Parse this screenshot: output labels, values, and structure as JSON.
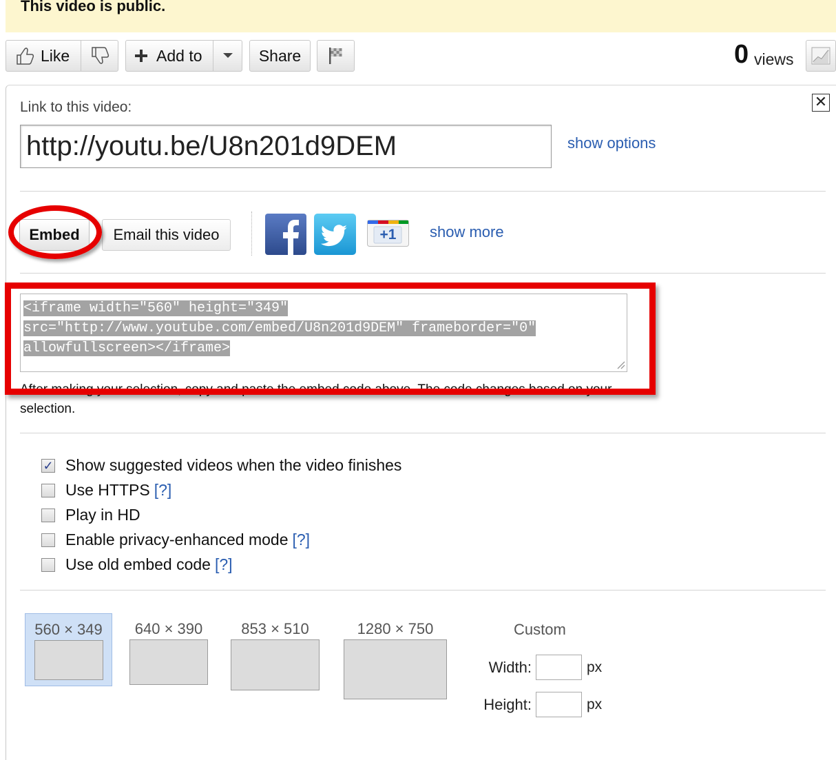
{
  "banner": {
    "text": "This video is public."
  },
  "toolbar": {
    "like_label": "Like",
    "add_to_label": "Add to",
    "share_label": "Share",
    "views_count": "0",
    "views_label": "views"
  },
  "link": {
    "label": "Link to this video:",
    "url": "http://youtu.be/U8n201d9DEM",
    "options_link": "show options"
  },
  "share": {
    "embed_label": "Embed",
    "email_label": "Email this video",
    "gplus_label": "+1",
    "more_link": "show more"
  },
  "embed": {
    "code_lines": [
      "<iframe width=\"560\" height=\"349\"",
      "src=\"http://www.youtube.com/embed/U8n201d9DEM\" frameborder=\"0\"",
      "allowfullscreen></iframe>"
    ],
    "help_text": "After making your selection, copy and paste the embed code above. The code changes based on your selection."
  },
  "options": [
    {
      "label": "Show suggested videos when the video finishes",
      "checked": true,
      "help": ""
    },
    {
      "label": "Use HTTPS",
      "checked": false,
      "help": "[?]"
    },
    {
      "label": "Play in HD",
      "checked": false,
      "help": ""
    },
    {
      "label": "Enable privacy-enhanced mode",
      "checked": false,
      "help": "[?]"
    },
    {
      "label": "Use old embed code",
      "checked": false,
      "help": "[?]"
    }
  ],
  "sizes": [
    {
      "label": "560 × 349",
      "selected": true
    },
    {
      "label": "640 × 390",
      "selected": false
    },
    {
      "label": "853 × 510",
      "selected": false
    },
    {
      "label": "1280 × 750",
      "selected": false
    }
  ],
  "custom": {
    "title": "Custom",
    "width_label": "Width:",
    "height_label": "Height:",
    "unit": "px",
    "width_value": "",
    "height_value": ""
  },
  "colors": {
    "annotation_red": "#e60000",
    "link_blue": "#2a5db0",
    "banner_yellow": "#fdf6cf",
    "selected_size_bg": "#cfe0f6"
  }
}
